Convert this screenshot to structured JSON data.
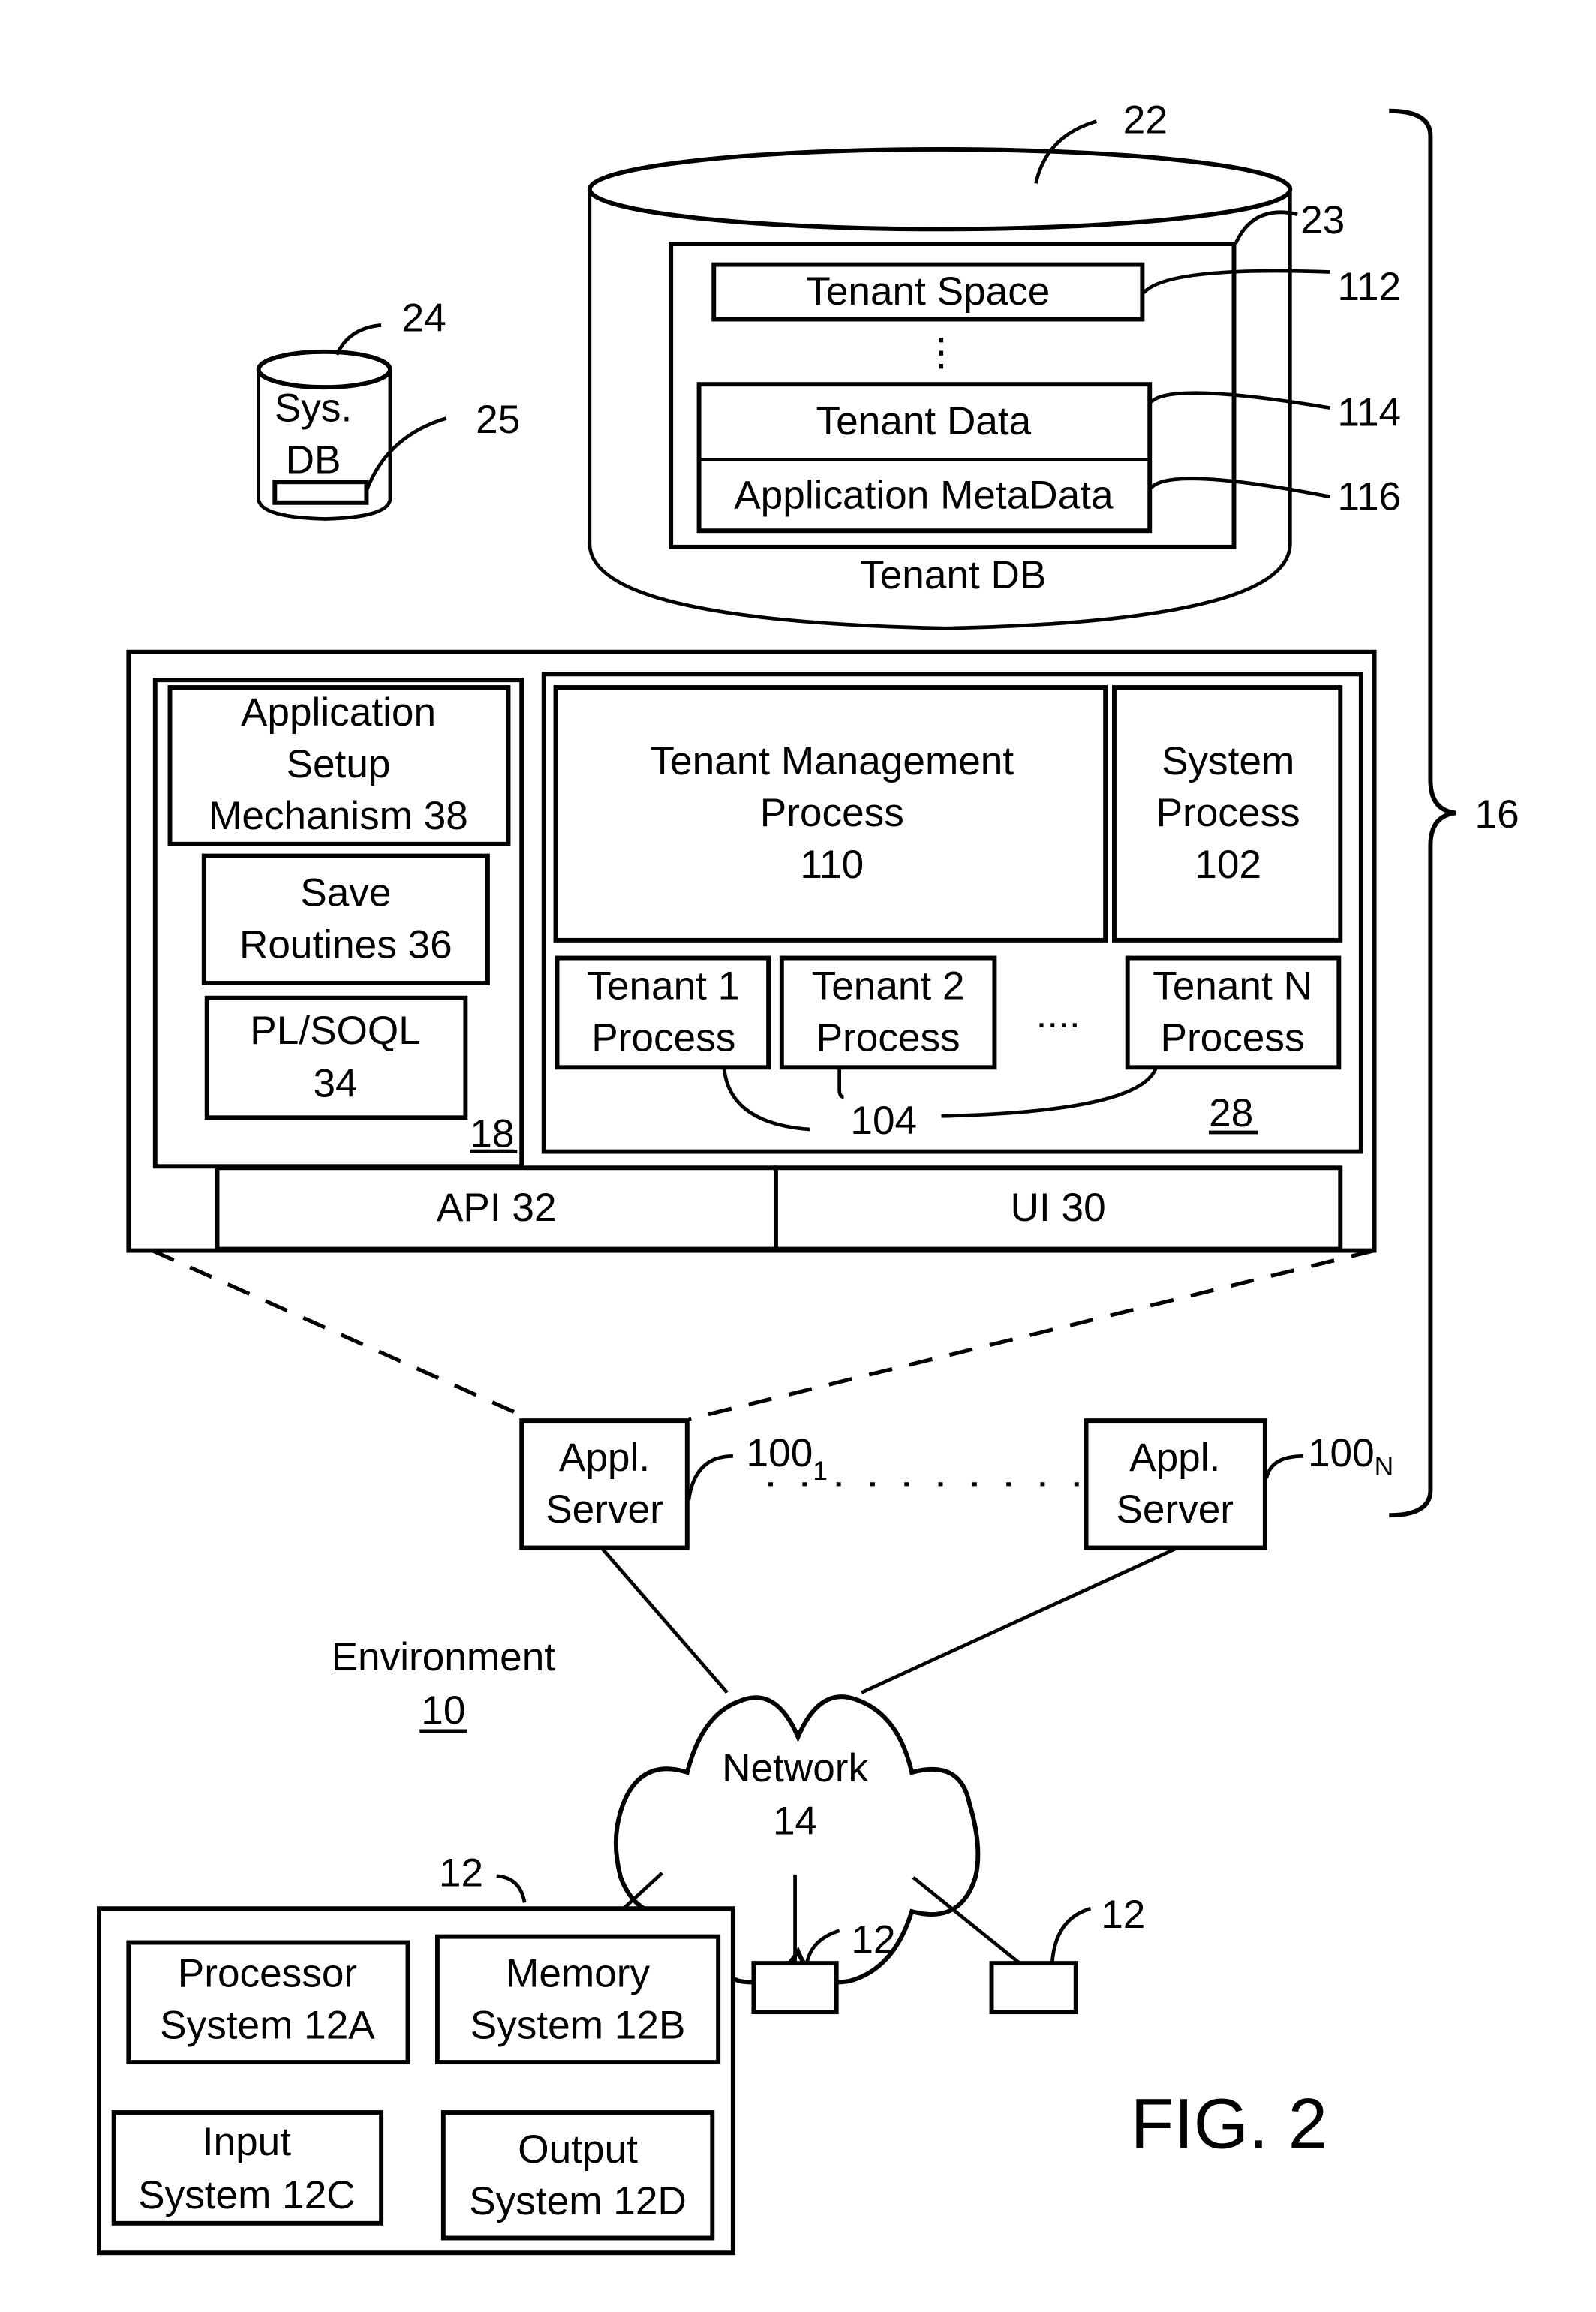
{
  "figure": {
    "caption": "FIG. 2",
    "environment": {
      "label": "Environment",
      "ref": "10"
    }
  },
  "tenant_db": {
    "ref": "22",
    "label": "Tenant DB",
    "storage_ref": "23",
    "tenant_space": {
      "label": "Tenant Space",
      "ref": "112"
    },
    "ellipsis": "⋮",
    "tenant_data": {
      "label": "Tenant Data",
      "ref": "114"
    },
    "app_metadata": {
      "label": "Application MetaData",
      "ref": "116"
    }
  },
  "sys_db": {
    "ref": "24",
    "label_line1": "Sys.",
    "label_line2": "DB",
    "storage_ref": "25"
  },
  "system_bracket": {
    "ref": "16"
  },
  "app_platform": {
    "ref": "18",
    "app_setup": {
      "line1": "Application",
      "line2": "Setup",
      "line3": "Mechanism 38"
    },
    "save_routines": {
      "line1": "Save",
      "line2": "Routines 36"
    },
    "plsoql": {
      "line1": "PL/SOQL",
      "line2": "34"
    }
  },
  "process_space": {
    "ref": "28",
    "tenant_mgmt": {
      "line1": "Tenant Management",
      "line2": "Process",
      "line3": "110"
    },
    "system_process": {
      "line1": "System",
      "line2": "Process",
      "line3": "102"
    },
    "tenant_processes": [
      {
        "line1": "Tenant 1",
        "line2": "Process"
      },
      {
        "line1": "Tenant 2",
        "line2": "Process"
      },
      {
        "line1": "Tenant N",
        "line2": "Process"
      }
    ],
    "ellipsis": "....",
    "tenant_process_ref": "104"
  },
  "interfaces": {
    "api": "API 32",
    "ui": "UI 30"
  },
  "app_servers": [
    {
      "line1": "Appl.",
      "line2": "Server",
      "ref_base": "100",
      "ref_sub": "1"
    },
    {
      "line1": "Appl.",
      "line2": "Server",
      "ref_base": "100",
      "ref_sub": "N"
    }
  ],
  "network": {
    "line1": "Network",
    "line2": "14"
  },
  "user_system": {
    "ref": "12",
    "processor": {
      "line1": "Processor",
      "line2": "System 12A"
    },
    "memory": {
      "line1": "Memory",
      "line2": "System 12B"
    },
    "input": {
      "line1": "Input",
      "line2": "System 12C"
    },
    "output": {
      "line1": "Output",
      "line2": "System 12D"
    }
  },
  "other_user_systems": [
    {
      "ref": "12"
    },
    {
      "ref": "12"
    }
  ]
}
